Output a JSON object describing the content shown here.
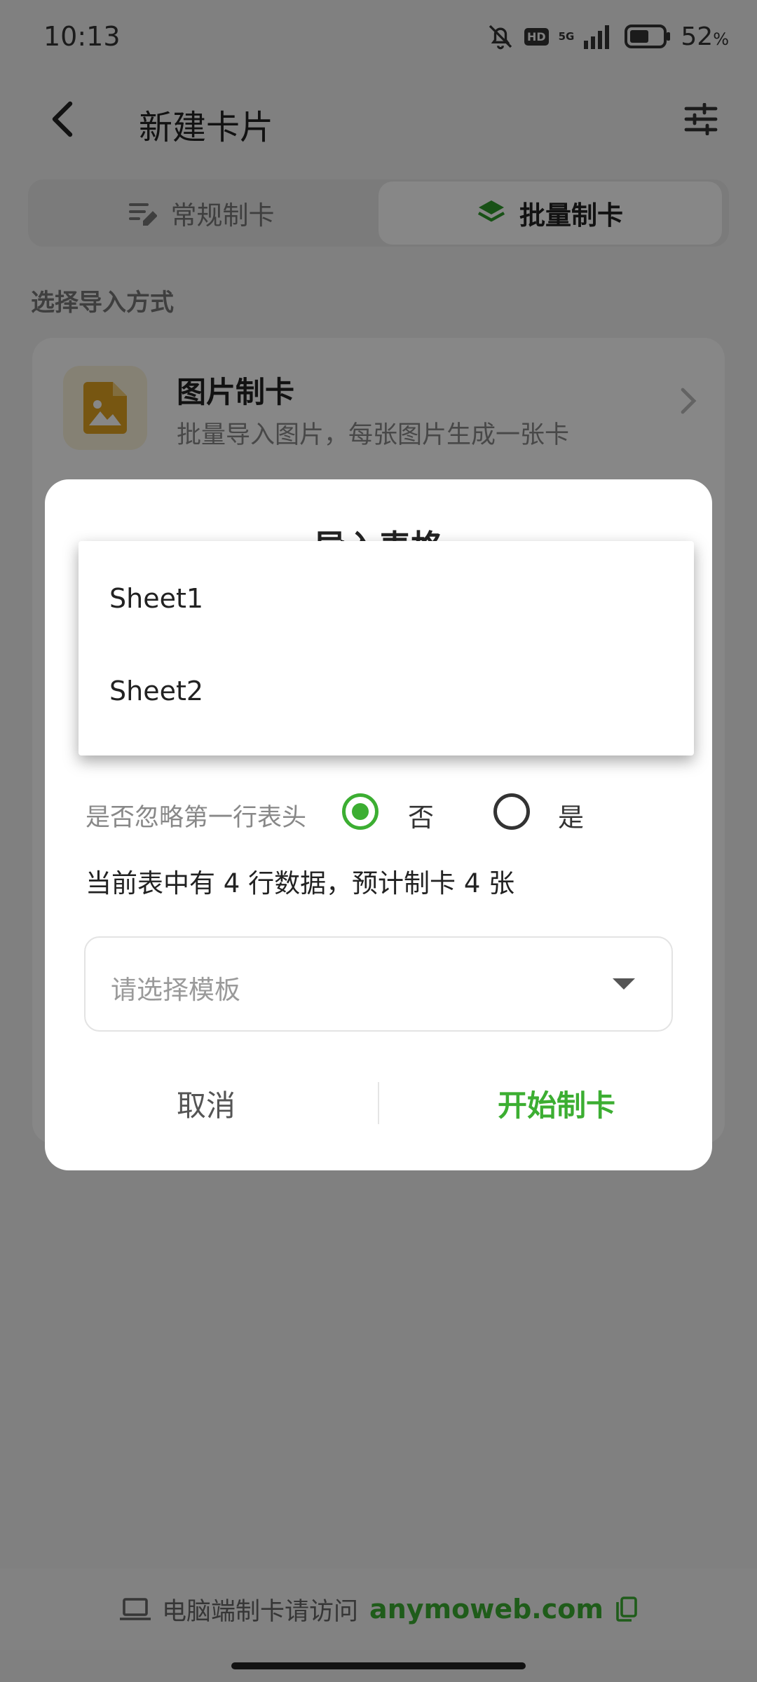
{
  "status_bar": {
    "time": "10:13",
    "hd_badge": "HD",
    "network": "5G",
    "battery": "52",
    "battery_unit": "%"
  },
  "app_bar": {
    "title": "新建卡片",
    "back_icon": "chevron-left-icon",
    "filter_icon": "sliders-icon"
  },
  "mode_tabs": [
    {
      "label": "常规制卡",
      "icon": "list-edit-icon",
      "selected": false
    },
    {
      "label": "批量制卡",
      "icon": "layers-icon",
      "selected": true
    }
  ],
  "section_label": "选择导入方式",
  "method_card": {
    "title": "图片制卡",
    "description": "批量导入图片，每张图片生成一张卡",
    "icon": "image-icon"
  },
  "dialog": {
    "title": "导入表格",
    "ignore_header_label": "是否忽略第一行表头",
    "option_no": "否",
    "option_yes": "是",
    "selected_option": "否",
    "row_info": "当前表中有 4 行数据，预计制卡 4 张",
    "template_placeholder": "请选择模板",
    "cancel_label": "取消",
    "start_label": "开始制卡"
  },
  "sheet_menu": {
    "items": [
      "Sheet1",
      "Sheet2"
    ]
  },
  "footer": {
    "text": "电脑端制卡请访问",
    "link": "anymoweb.com"
  },
  "colors": {
    "accent": "#3cae32",
    "scrim": "rgba(0,0,0,0.47)",
    "icon_amber": "#e1a321"
  }
}
